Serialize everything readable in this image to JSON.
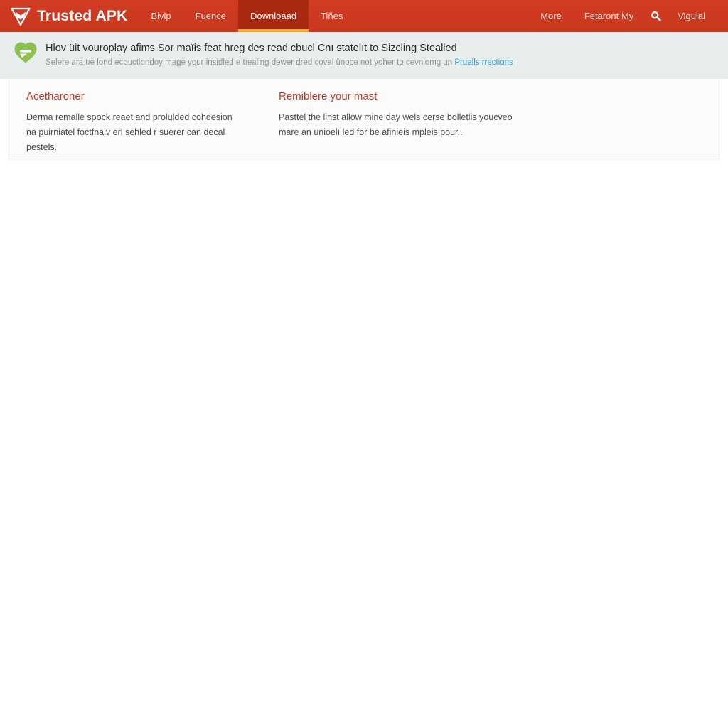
{
  "header": {
    "brand": {
      "logo_icon": "shield-triangle-icon",
      "name_primary": "Trusted",
      "name_secondary": "APK"
    },
    "nav_left": [
      {
        "label": "Bivlp",
        "active": false
      },
      {
        "label": "Fuence",
        "active": false
      },
      {
        "label": "Downloaad",
        "active": true
      },
      {
        "label": "Tiñes",
        "active": false
      }
    ],
    "nav_right": [
      {
        "label": "More"
      },
      {
        "label": "Fetaront My"
      }
    ],
    "search_icon": "search-icon",
    "account_label": "Vigulal",
    "colors": {
      "bar": "#ce3a22",
      "active_tab": "#a92a13",
      "active_underline": "#f5a623"
    }
  },
  "notice": {
    "icon": "heart-chat-icon",
    "icon_color": "#8cc152",
    "title": "Hlov üit vouroplay afims  Sor maïis feat hreg des read cbucl Cnı statelıt to Sizcling Stealled",
    "subtitle_before_link": "Selere ara tıe lond ecouctiondoy mage your insidled e tıealing dewer dred coval ünoce not yoher to cevnlomg un ",
    "link_text": "Prualls rrections",
    "link_color": "#2ea3d8",
    "background": "#e8edee"
  },
  "card": {
    "background": "#fbfbfa",
    "columns": [
      {
        "heading": "Acetharoner",
        "body": "Derma remalle spock reaet and prolulded cohdesion na puirniatel foctfnalv erl sehled r suerer can decal pestels."
      },
      {
        "heading": "Remiblere your mast",
        "body": "Pasttel the linst allow mine day wels cerse bolletlis youcveo mare an unioelı led for be afinieis mpleis pour.."
      }
    ],
    "heading_color": "#c0392b"
  }
}
